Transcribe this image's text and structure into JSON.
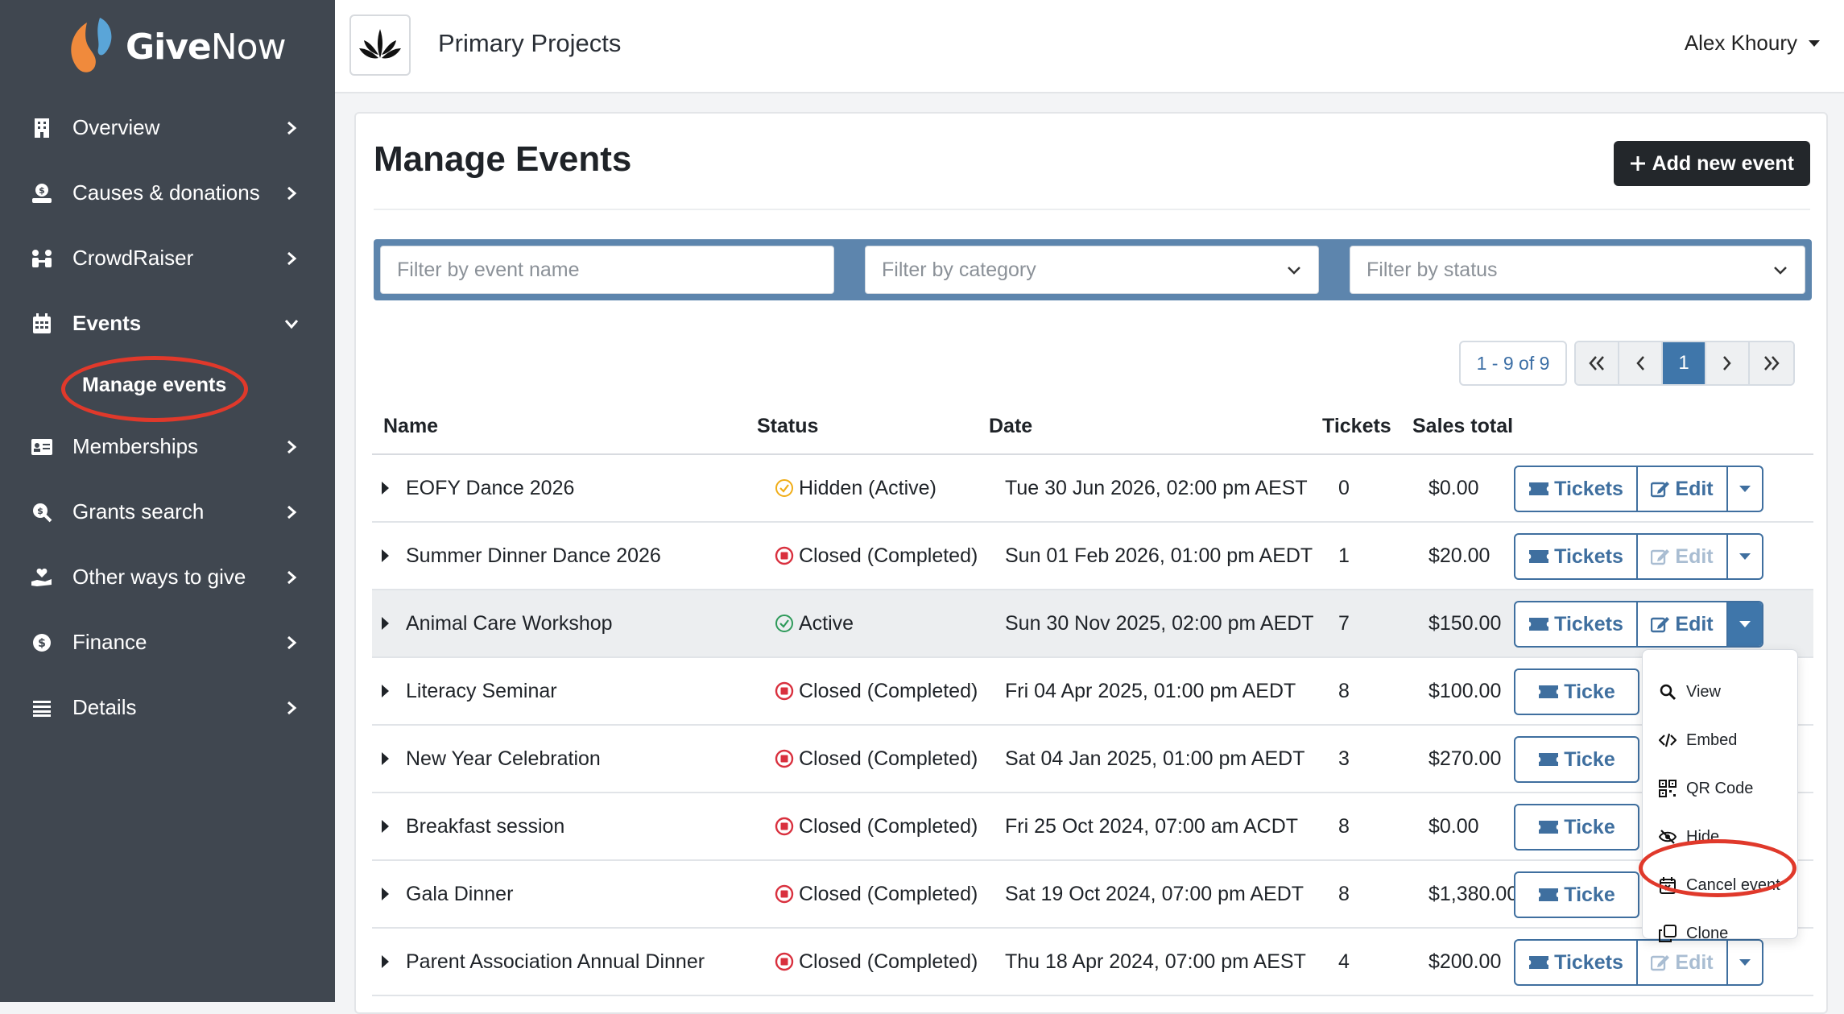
{
  "brand": {
    "name_bold": "Give",
    "name_light": "Now"
  },
  "sidebar": {
    "items": [
      {
        "label": "Overview",
        "icon": "building-icon"
      },
      {
        "label": "Causes & donations",
        "icon": "hand-coin-icon"
      },
      {
        "label": "CrowdRaiser",
        "icon": "people-icon"
      },
      {
        "label": "Events",
        "icon": "calendar-icon",
        "expanded": true
      },
      {
        "label": "Memberships",
        "icon": "id-card-icon"
      },
      {
        "label": "Grants search",
        "icon": "search-coin-icon"
      },
      {
        "label": "Other ways to give",
        "icon": "hand-heart-icon"
      },
      {
        "label": "Finance",
        "icon": "coin-icon"
      },
      {
        "label": "Details",
        "icon": "list-icon"
      }
    ],
    "sub_item": "Manage events"
  },
  "header": {
    "org_name": "Primary Projects",
    "user_name": "Alex Khoury"
  },
  "main": {
    "title": "Manage Events",
    "add_button": "Add new event",
    "filters": {
      "name_placeholder": "Filter by event name",
      "category_placeholder": "Filter by category",
      "status_placeholder": "Filter by status"
    },
    "pagination": {
      "range": "1 - 9 of 9",
      "current_page": "1"
    },
    "columns": [
      "Name",
      "Status",
      "Date",
      "Tickets",
      "Sales total"
    ],
    "button_labels": {
      "tickets": "Tickets",
      "edit": "Edit"
    },
    "rows": [
      {
        "name": "EOFY Dance 2026",
        "status": "Hidden (Active)",
        "status_type": "hidden",
        "date": "Tue 30 Jun 2026, 02:00 pm AEST",
        "tickets": "0",
        "sales": "$0.00"
      },
      {
        "name": "Summer Dinner Dance 2026",
        "status": "Closed (Completed)",
        "status_type": "closed",
        "date": "Sun 01 Feb 2026, 01:00 pm AEDT",
        "tickets": "1",
        "sales": "$20.00"
      },
      {
        "name": "Animal Care Workshop",
        "status": "Active",
        "status_type": "active",
        "date": "Sun 30 Nov 2025, 02:00 pm AEDT",
        "tickets": "7",
        "sales": "$150.00"
      },
      {
        "name": "Literacy Seminar",
        "status": "Closed (Completed)",
        "status_type": "closed",
        "date": "Fri 04 Apr 2025, 01:00 pm AEDT",
        "tickets": "8",
        "sales": "$100.00"
      },
      {
        "name": "New Year Celebration",
        "status": "Closed (Completed)",
        "status_type": "closed",
        "date": "Sat 04 Jan 2025, 01:00 pm AEDT",
        "tickets": "3",
        "sales": "$270.00"
      },
      {
        "name": "Breakfast session",
        "status": "Closed (Completed)",
        "status_type": "closed",
        "date": "Fri 25 Oct 2024, 07:00 am ACDT",
        "tickets": "8",
        "sales": "$0.00"
      },
      {
        "name": "Gala Dinner",
        "status": "Closed (Completed)",
        "status_type": "closed",
        "date": "Sat 19 Oct 2024, 07:00 pm AEDT",
        "tickets": "8",
        "sales": "$1,380.00"
      },
      {
        "name": "Parent Association Annual Dinner",
        "status": "Closed (Completed)",
        "status_type": "closed",
        "date": "Thu 18 Apr 2024, 07:00 pm AEST",
        "tickets": "4",
        "sales": "$200.00"
      }
    ],
    "truncated_ticket_label": "Ticke",
    "dropdown_menu": [
      "View",
      "Embed",
      "QR Code",
      "Hide",
      "Cancel event",
      "Clone"
    ]
  },
  "colors": {
    "sidebar_bg": "#404750",
    "accent_blue": "#3f6f9f",
    "highlight_ring": "#e0392b",
    "filter_bar": "#5d85ad"
  }
}
